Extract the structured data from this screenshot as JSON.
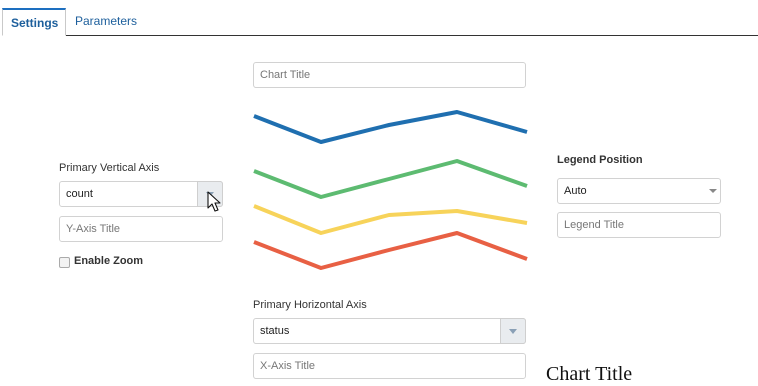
{
  "tabs": [
    {
      "label": "Settings",
      "active": true
    },
    {
      "label": "Parameters",
      "active": false
    }
  ],
  "chart_title_input": {
    "placeholder": "Chart Title",
    "value": ""
  },
  "illustration_series_colors": [
    "#1f6fb0",
    "#5dbb71",
    "#f7d35a",
    "#e86044"
  ],
  "primary_vertical_axis": {
    "label": "Primary Vertical Axis",
    "selected": "count",
    "title_placeholder": "Y-Axis Title",
    "enable_zoom_label": "Enable Zoom",
    "enable_zoom_checked": false
  },
  "legend": {
    "label": "Legend Position",
    "selected": "Auto",
    "title_placeholder": "Legend Title"
  },
  "primary_horizontal_axis": {
    "label": "Primary Horizontal Axis",
    "selected": "status",
    "title_placeholder": "X-Axis Title"
  },
  "preview_chart_title": "Chart Title"
}
